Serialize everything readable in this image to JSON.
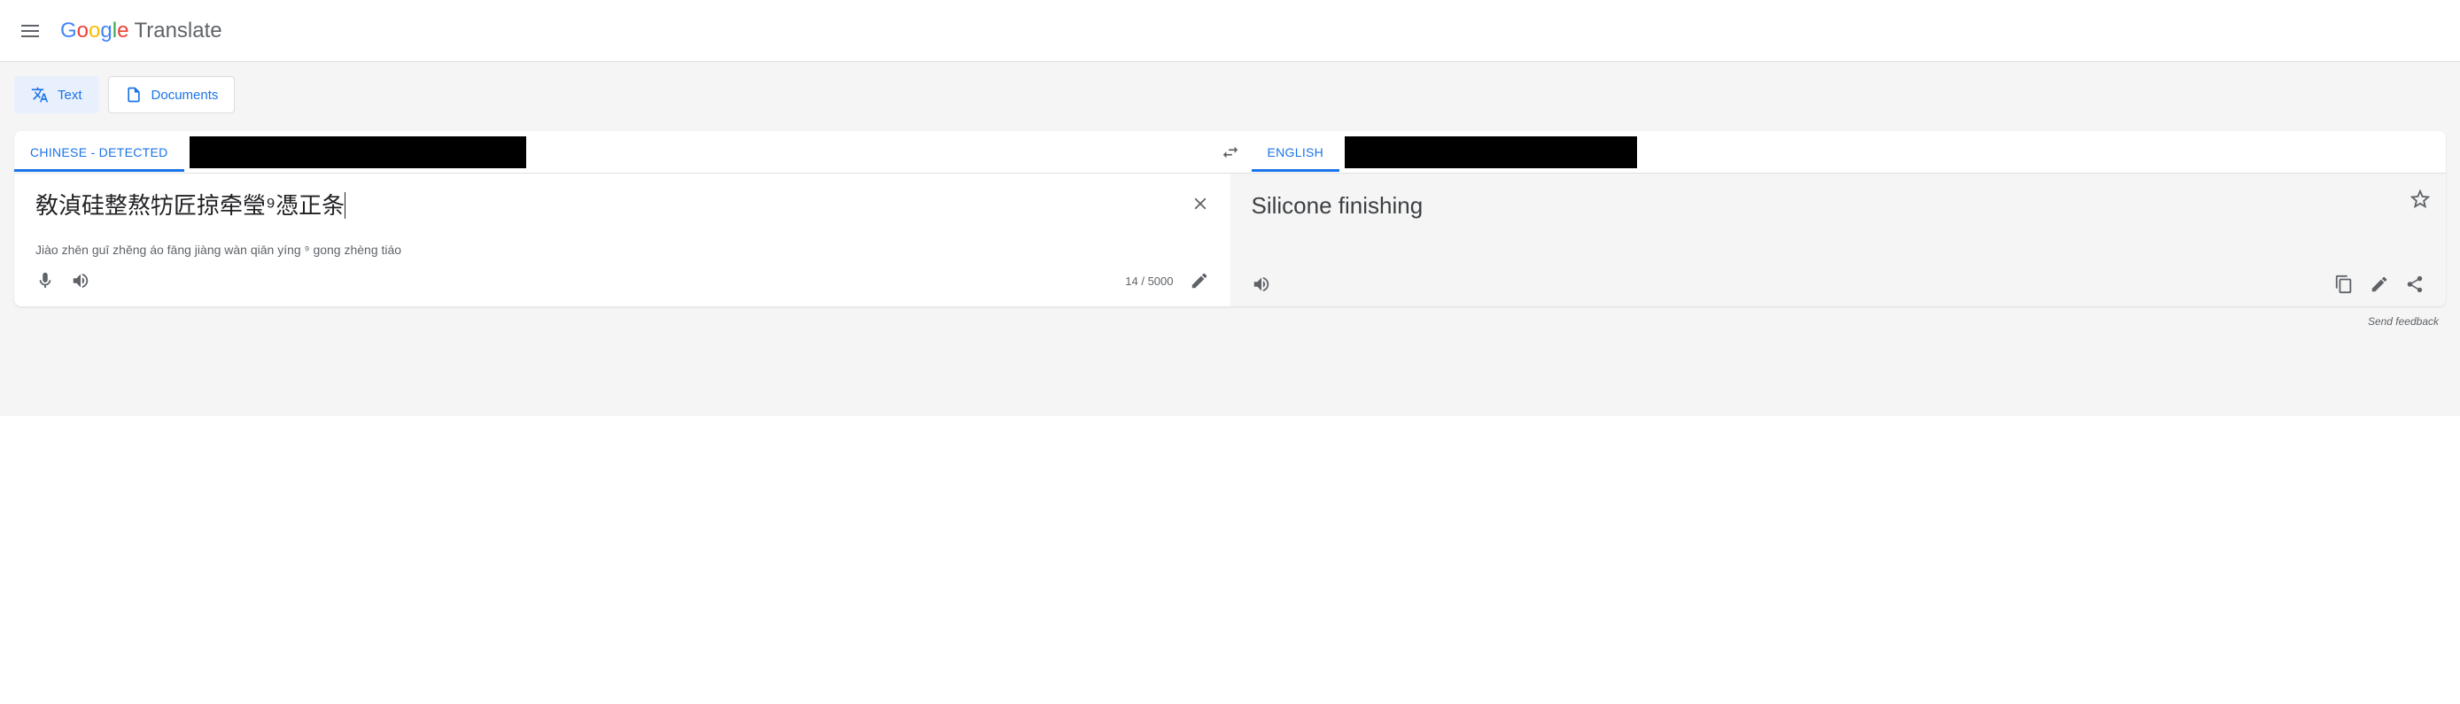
{
  "header": {
    "logo_brand": "Google",
    "logo_product": "Translate"
  },
  "mode_tabs": {
    "text": "Text",
    "documents": "Documents"
  },
  "lang": {
    "source_active": "CHINESE - DETECTED",
    "target_active": "ENGLISH"
  },
  "source": {
    "text": "敎湞硅整熬牥匠掠牵瑩⁹憑正条",
    "romanization": "Jiào zhēn guī zhěng áo fāng jiàng wàn qiān yíng ⁹ gong zhèng tiáo",
    "char_count": "14 / 5000"
  },
  "target": {
    "text": "Silicone finishing"
  },
  "footer": {
    "feedback": "Send feedback"
  }
}
